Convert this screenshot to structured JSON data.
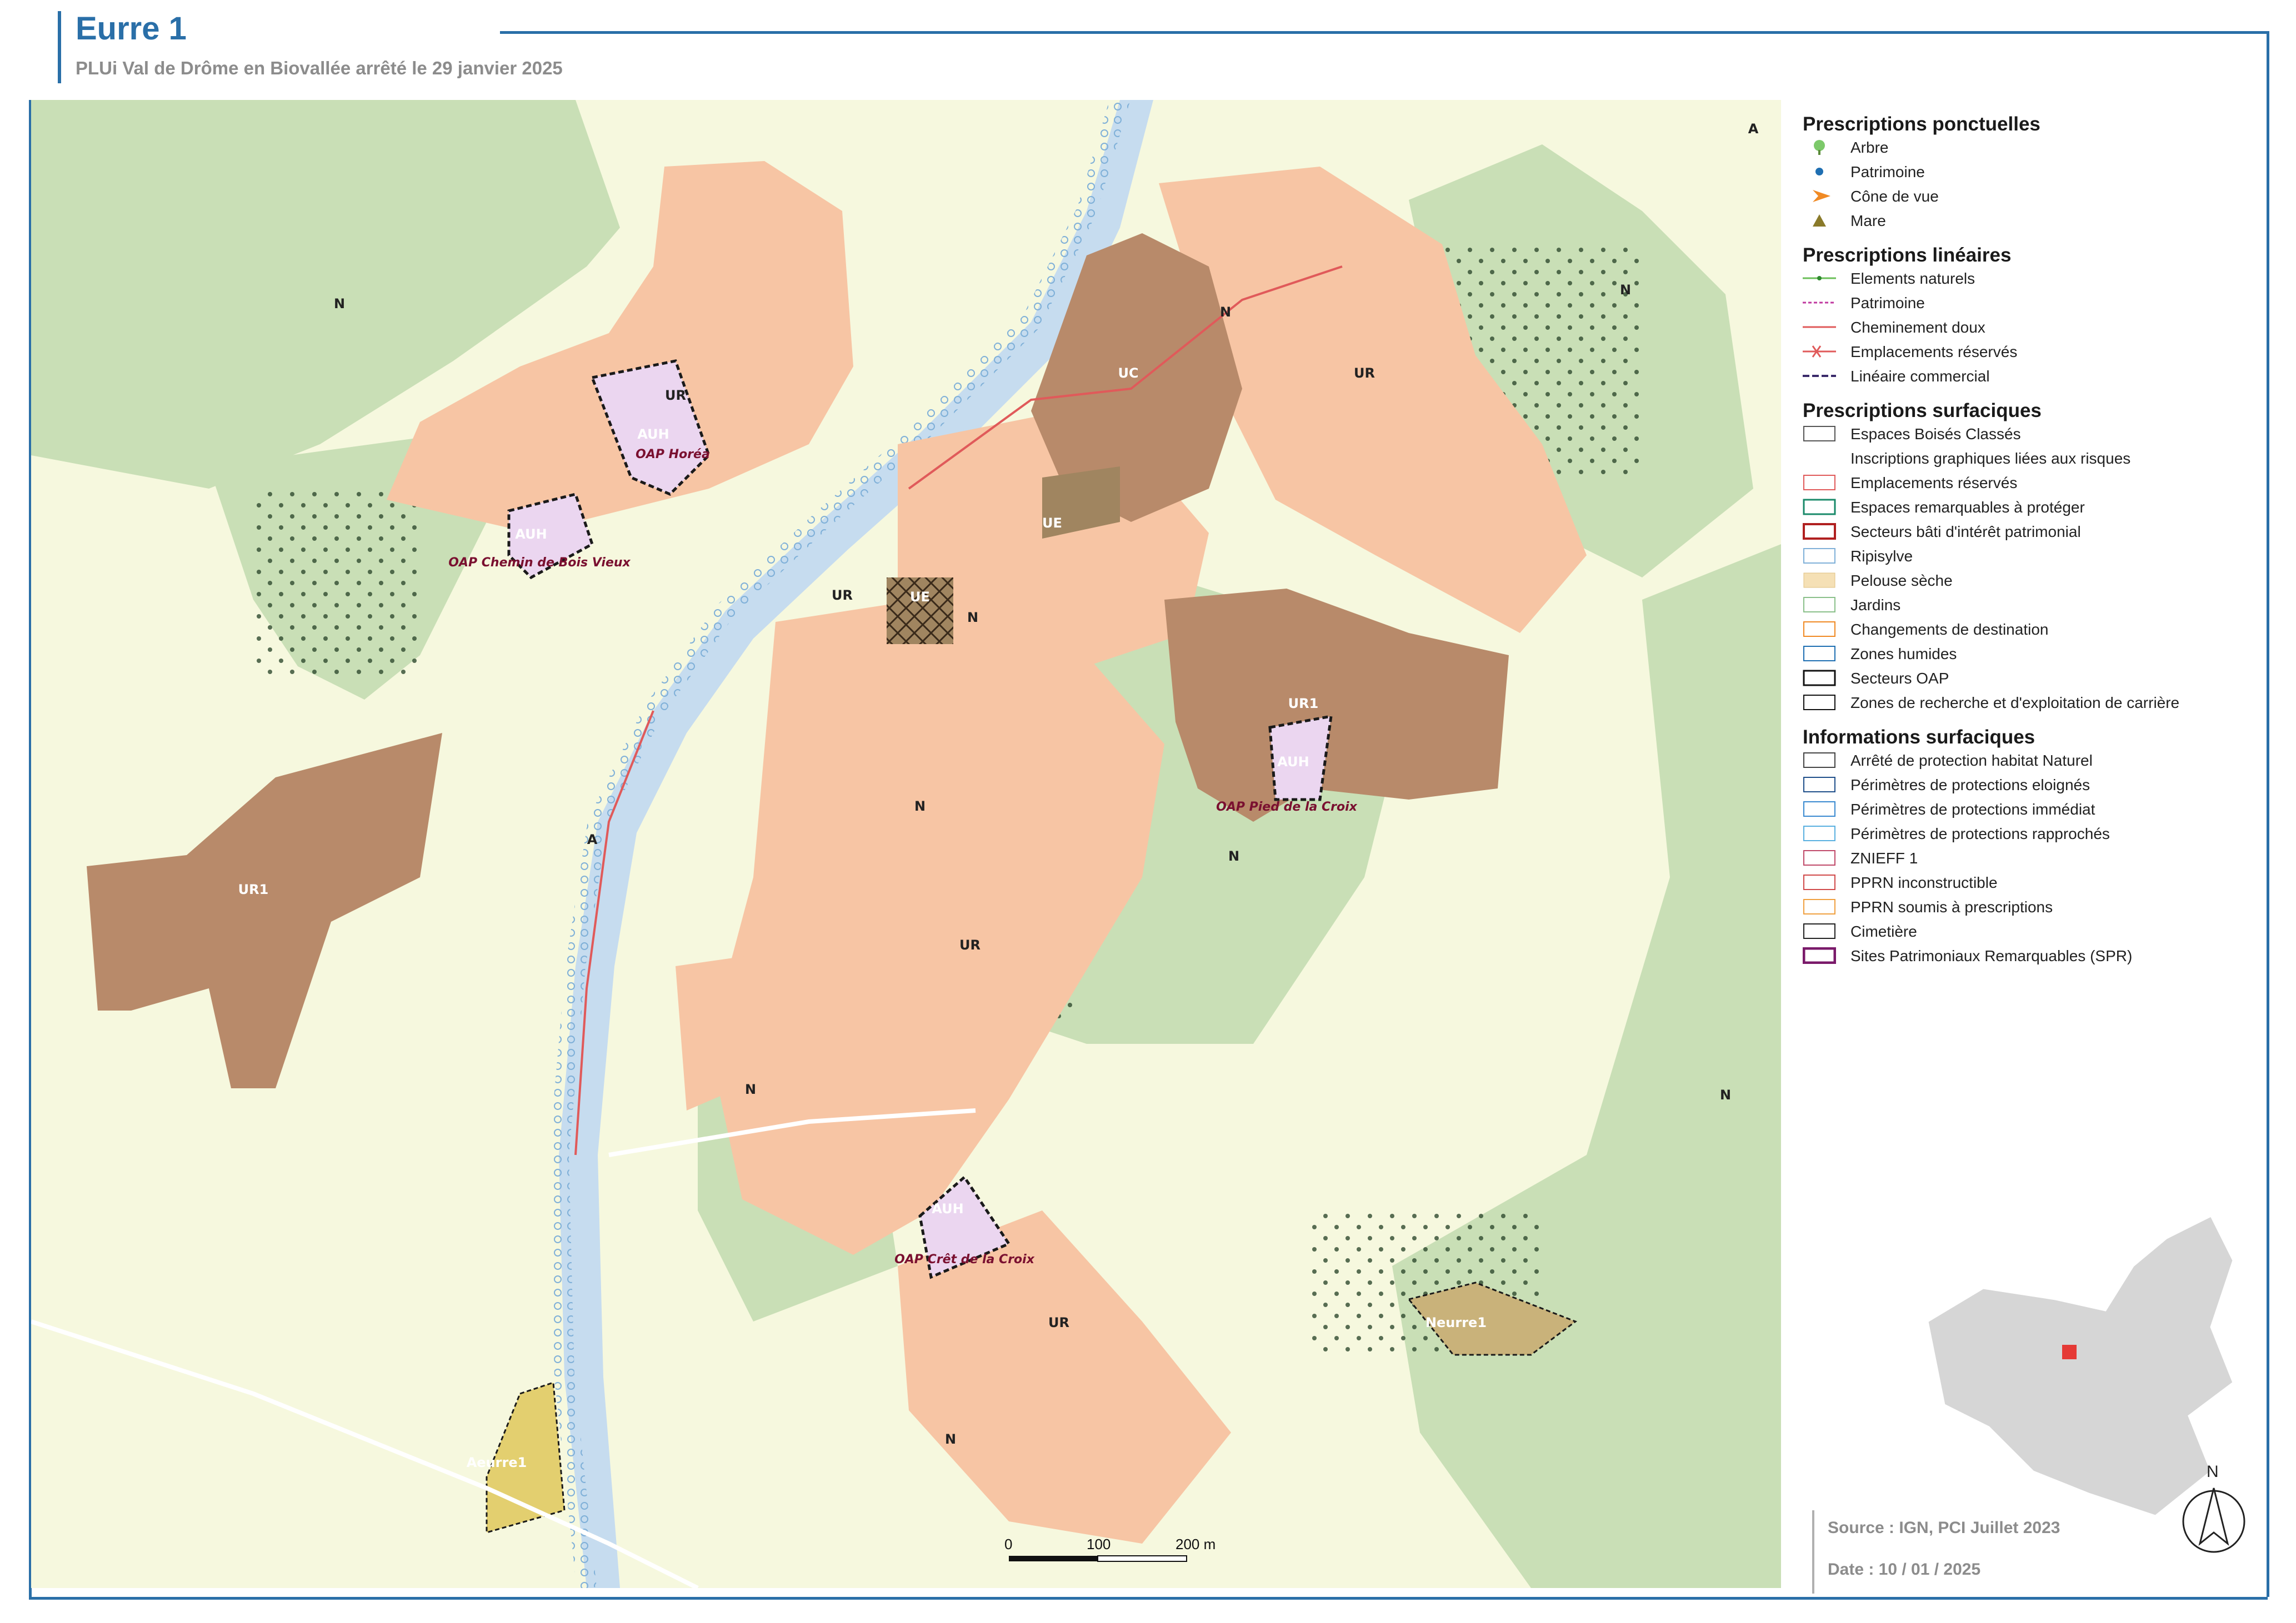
{
  "header": {
    "title": "Eurre 1",
    "subtitle": "PLUi Val de Drôme en Biovallée arrêté le 29 janvier 2025"
  },
  "colors": {
    "frame": "#2a6fa8",
    "agri_zone": "#f6f8de",
    "natural_zone": "#c9dfb6",
    "urban_zone_UR": "#f7c5a4",
    "urban_zone_UC_UR1": "#b88a6a",
    "auh_zone": "#ebd6f0",
    "ue_zone": "#a08560",
    "building": "#9e7b62",
    "river": "#c6dcef",
    "neurre": "#c9b27a",
    "aeurre": "#e3cf6f"
  },
  "map": {
    "zone_labels": [
      {
        "text": "N"
      },
      {
        "text": "N"
      },
      {
        "text": "N"
      },
      {
        "text": "N"
      },
      {
        "text": "N"
      },
      {
        "text": "N"
      },
      {
        "text": "N"
      },
      {
        "text": "N"
      },
      {
        "text": "N"
      },
      {
        "text": "A"
      },
      {
        "text": "A"
      },
      {
        "text": "UR"
      },
      {
        "text": "UR"
      },
      {
        "text": "UR"
      },
      {
        "text": "UR"
      },
      {
        "text": "UR"
      },
      {
        "text": "UC"
      },
      {
        "text": "UE"
      },
      {
        "text": "UE"
      },
      {
        "text": "UR1"
      },
      {
        "text": "UR1"
      },
      {
        "text": "AUH"
      },
      {
        "text": "AUH"
      },
      {
        "text": "AUH"
      },
      {
        "text": "AUH"
      }
    ],
    "oap_labels": [
      {
        "text": "OAP Horéa"
      },
      {
        "text": "OAP Chemin de Bois Vieux"
      },
      {
        "text": "OAP Pied de la Croix"
      },
      {
        "text": "OAP Crêt de la Croix"
      }
    ],
    "special_labels": [
      {
        "text": "Neurre1"
      },
      {
        "text": "Aeurre1"
      }
    ],
    "scale": {
      "labels": [
        "0",
        "100",
        "200 m"
      ]
    },
    "north": "N"
  },
  "legend": {
    "sections": [
      {
        "title": "Prescriptions ponctuelles",
        "items": [
          {
            "label": "Arbre",
            "icon": "tree-icon"
          },
          {
            "label": "Patrimoine",
            "icon": "heritage-dot-icon"
          },
          {
            "label": "Cône de vue",
            "icon": "view-cone-icon"
          },
          {
            "label": "Mare",
            "icon": "pond-triangle-icon"
          }
        ]
      },
      {
        "title": "Prescriptions linéaires",
        "items": [
          {
            "label": "Elements naturels",
            "icon": "natural-line-icon"
          },
          {
            "label": "Patrimoine",
            "icon": "heritage-line-icon"
          },
          {
            "label": "Cheminement doux",
            "icon": "soft-path-line-icon"
          },
          {
            "label": "Emplacements réservés",
            "icon": "reserved-line-icon"
          },
          {
            "label": "Linéaire commercial",
            "icon": "commercial-line-icon"
          }
        ]
      },
      {
        "title": "Prescriptions surfaciques",
        "items": [
          {
            "label": "Espaces Boisés Classés",
            "icon": "classified-woods-icon"
          },
          {
            "label": "Inscriptions graphiques liées aux risques",
            "icon": "risk-dots-icon"
          },
          {
            "label": "Emplacements réservés",
            "icon": "reserved-area-icon"
          },
          {
            "label": "Espaces remarquables à protéger",
            "icon": "remarkable-space-icon"
          },
          {
            "label": "Secteurs bâti d'intérêt patrimonial",
            "icon": "heritage-sector-icon"
          },
          {
            "label": "Ripisylve",
            "icon": "ripisylve-icon"
          },
          {
            "label": "Pelouse sèche",
            "icon": "dry-lawn-icon"
          },
          {
            "label": "Jardins",
            "icon": "gardens-icon"
          },
          {
            "label": "Changements de destination",
            "icon": "destination-change-icon"
          },
          {
            "label": "Zones humides",
            "icon": "wetland-icon"
          },
          {
            "label": "Secteurs OAP",
            "icon": "oap-sector-icon"
          },
          {
            "label": "Zones de recherche et d'exploitation de carrière",
            "icon": "quarry-icon"
          }
        ]
      },
      {
        "title": "Informations surfaciques",
        "items": [
          {
            "label": "Arrêté de protection habitat Naturel",
            "icon": "habitat-protection-icon"
          },
          {
            "label": "Périmètres de protections eloignés",
            "icon": "far-protection-icon"
          },
          {
            "label": "Périmètres de protections immédiat",
            "icon": "immediate-protection-icon"
          },
          {
            "label": "Périmètres de protections rapprochés",
            "icon": "close-protection-icon"
          },
          {
            "label": "ZNIEFF 1",
            "icon": "znieff-icon"
          },
          {
            "label": "PPRN inconstructible",
            "icon": "pprn-unbuildable-icon"
          },
          {
            "label": "PPRN soumis à prescriptions",
            "icon": "pprn-prescriptions-icon"
          },
          {
            "label": "Cimetière",
            "icon": "cemetery-icon"
          },
          {
            "label": "Sites Patrimoniaux Remarquables (SPR)",
            "icon": "spr-icon"
          }
        ]
      }
    ]
  },
  "footer": {
    "source": "Source : IGN, PCI Juillet 2023",
    "date": "Date : 10 / 01 / 2025"
  }
}
